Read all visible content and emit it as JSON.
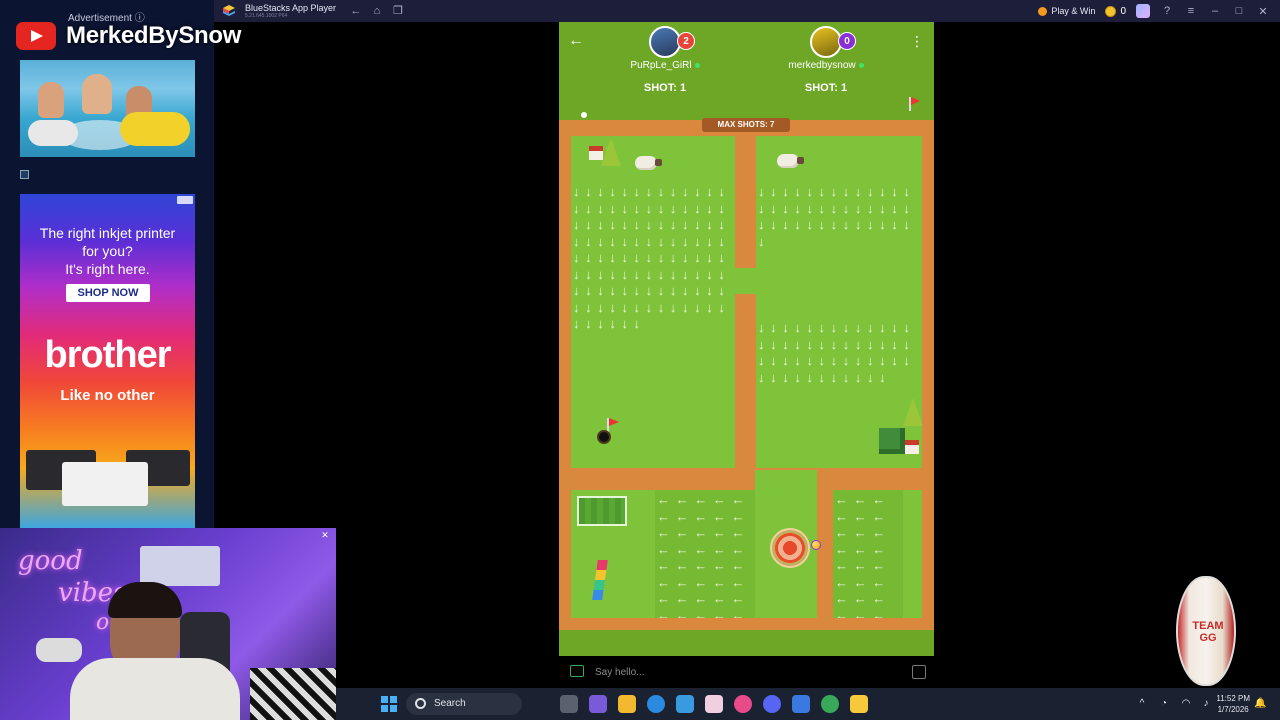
{
  "app": {
    "title": "BlueStacks App Player",
    "subtitle": "5.21.645.1002  P64",
    "play_win": "Play & Win",
    "coins": "0"
  },
  "ad": {
    "label": "Advertisement ⓘ",
    "headline1": "The right inkjet printer",
    "headline2": "for you?",
    "headline3": "It's right here.",
    "cta": "SHOP NOW",
    "brand": "brother",
    "tagline": "Like no other"
  },
  "stream": {
    "channel": "MerkedBySnow"
  },
  "webcam": {
    "neon_line1": "good",
    "neon_line2": "vibes",
    "neon_line3": "o"
  },
  "game": {
    "players": [
      {
        "name": "PuRpLe_GiRl",
        "score": "2",
        "shots": "SHOT: 1",
        "badge_color": "#e8453a"
      },
      {
        "name": "merkedbysnow",
        "score": "0",
        "shots": "SHOT: 1",
        "badge_color": "#8a2fd6"
      }
    ],
    "max_shots": "MAX SHOTS: 7",
    "chat_placeholder": "Say hello..."
  },
  "overlay": {
    "chip_text": "TEAM GG"
  },
  "taskbar": {
    "search": "Search",
    "time": "11:52 PM",
    "date": "1/7/2026"
  },
  "colors": {
    "grass": "#7ec33a",
    "path": "#d9883e",
    "header": "#6ea626",
    "titlebar": "#1d1f3a"
  }
}
